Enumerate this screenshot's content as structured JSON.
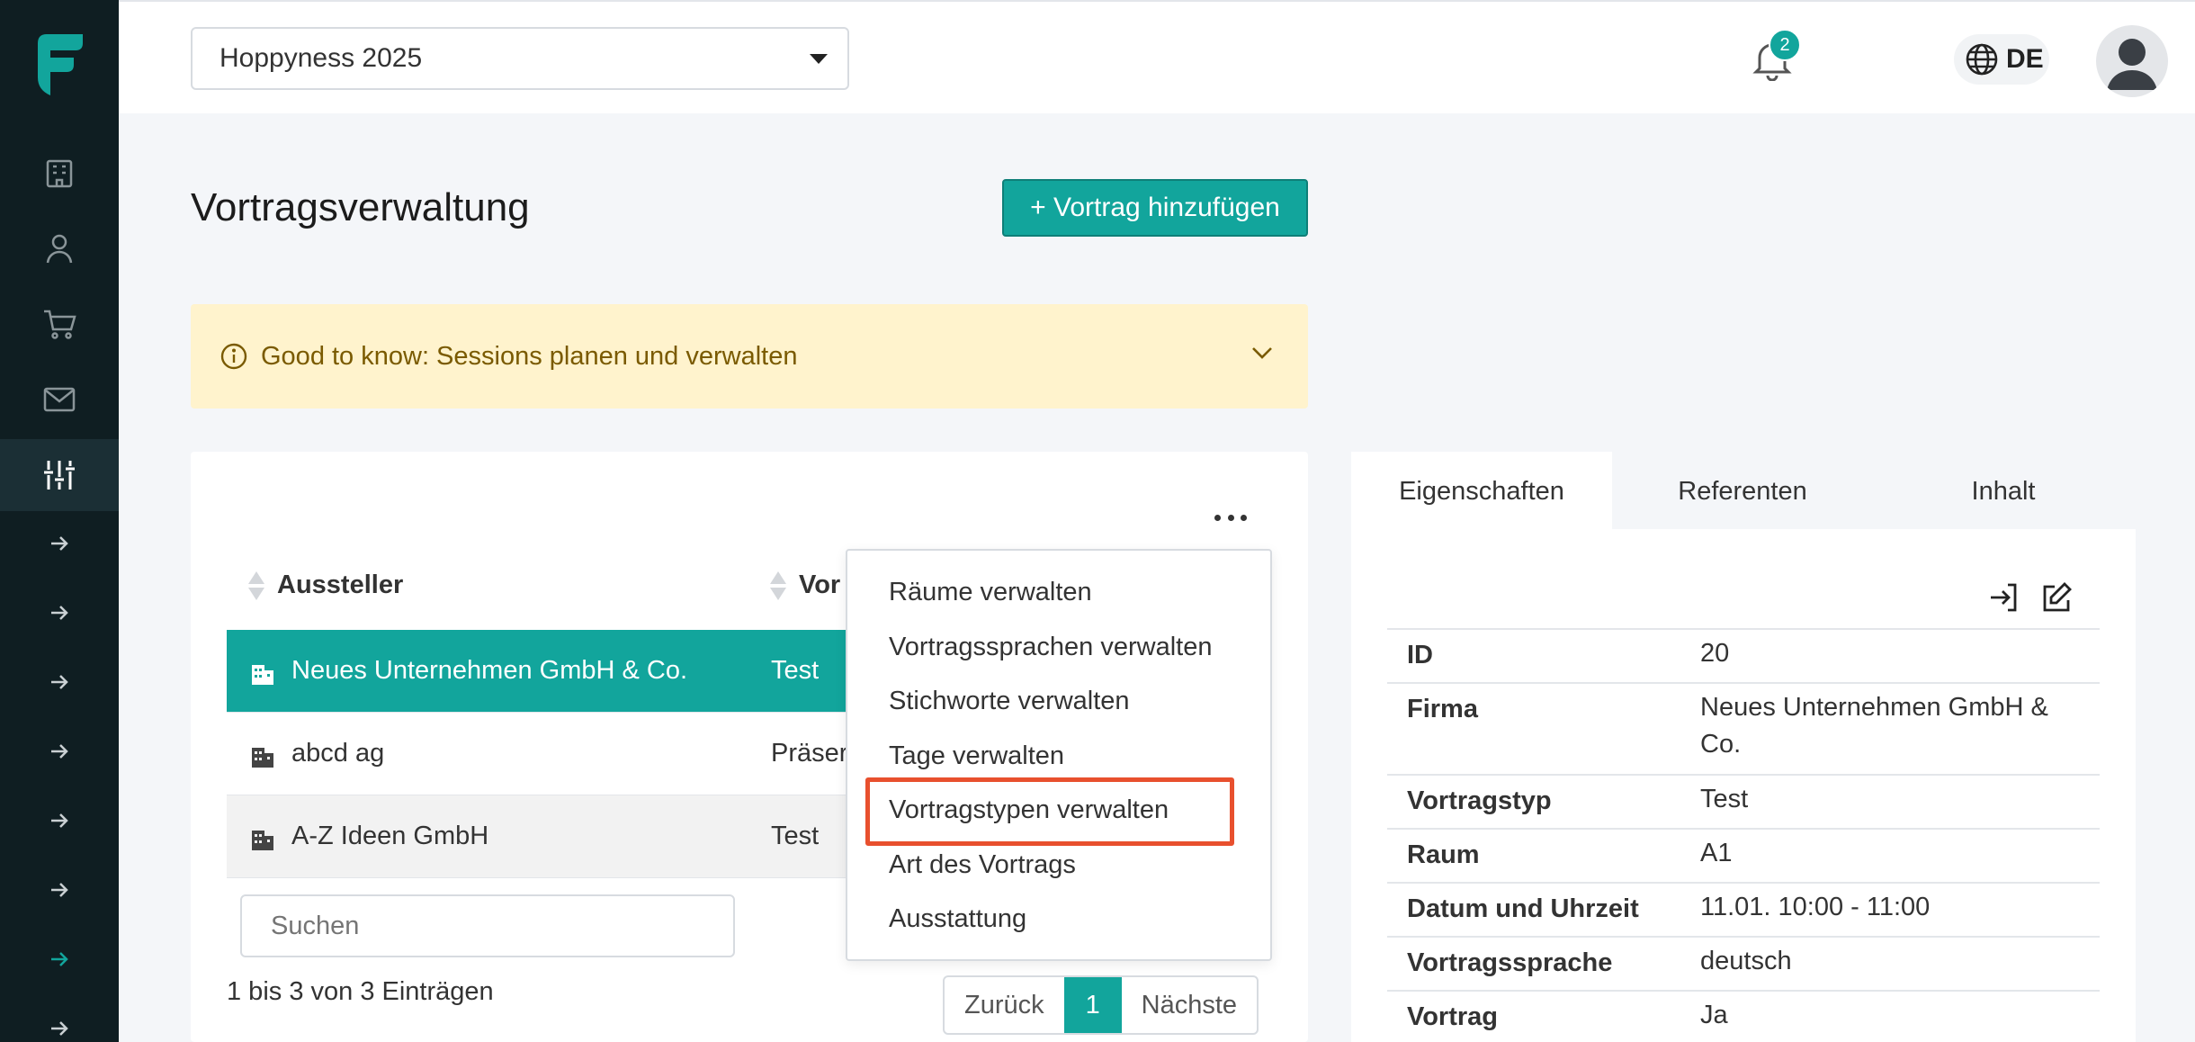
{
  "colors": {
    "accent": "#12a59c",
    "sidebar": "#0f1e22",
    "banner": "#fff3cd",
    "highlight": "#e8502e"
  },
  "sidebar": {
    "logo_icon": "brand-logo-icon",
    "items": [
      {
        "icon": "building-icon"
      },
      {
        "icon": "user-icon"
      },
      {
        "icon": "cart-icon"
      },
      {
        "icon": "mail-icon"
      },
      {
        "icon": "sliders-icon",
        "active": true
      }
    ],
    "sub_items_count_icon": "arrow-right-icon"
  },
  "header": {
    "event_select": {
      "value": "Hoppyness 2025"
    },
    "notifications": {
      "count": "2"
    },
    "language": "DE"
  },
  "page": {
    "title": "Vortragsverwaltung",
    "add_button": "+ Vortrag hinzufügen",
    "banner": "Good to know: Sessions planen und verwalten"
  },
  "table": {
    "columns": [
      "Aussteller",
      "Vor"
    ],
    "rows": [
      {
        "exhibitor": "Neues Unternehmen GmbH & Co.",
        "talk": "Test"
      },
      {
        "exhibitor": "abcd ag",
        "talk": "Präser"
      },
      {
        "exhibitor": "A-Z Ideen GmbH",
        "talk": "Test"
      }
    ],
    "search_placeholder": "Suchen",
    "entries_info": "1 bis 3 von 3 Einträgen",
    "pager": {
      "prev": "Zurück",
      "current": "1",
      "next": "Nächste"
    }
  },
  "menu": {
    "items": [
      "Räume verwalten",
      "Vortragssprachen verwalten",
      "Stichworte verwalten",
      "Tage verwalten",
      "Vortragstypen verwalten",
      "Art des Vortrags",
      "Ausstattung"
    ]
  },
  "details": {
    "tabs": [
      "Eigenschaften",
      "Referenten",
      "Inhalt"
    ],
    "properties": [
      {
        "key": "ID",
        "value": "20"
      },
      {
        "key": "Firma",
        "value": "Neues Unternehmen GmbH & Co."
      },
      {
        "key": "Vortragstyp",
        "value": "Test"
      },
      {
        "key": "Raum",
        "value": "A1"
      },
      {
        "key": "Datum und Uhrzeit",
        "value": "11.01. 10:00 - 11:00"
      },
      {
        "key": "Vortragssprache",
        "value": "deutsch"
      },
      {
        "key": "Vortrag",
        "value": "Ja"
      }
    ]
  }
}
